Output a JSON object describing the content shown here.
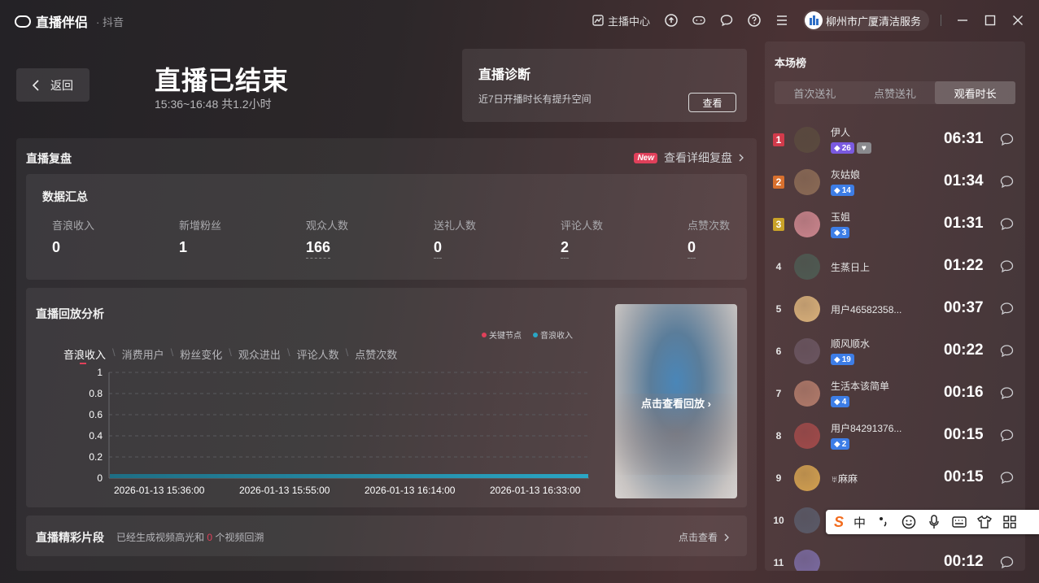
{
  "app": {
    "title": "直播伴侣",
    "subtitle": "· 抖音"
  },
  "titlebar": {
    "anchor_center": "主播中心",
    "icons": [
      "chart-icon",
      "upload-icon",
      "gamepad-icon",
      "chat-bubble-icon",
      "help-icon",
      "menu-icon"
    ],
    "user_name": "柳州市广厦清洁服务"
  },
  "header": {
    "back_label": "返回",
    "title": "直播已结束",
    "time_range": "15:36~16:48 共1.2小时"
  },
  "diagnosis": {
    "title": "直播诊断",
    "desc": "近7日开播时长有提升空间",
    "button": "查看"
  },
  "review": {
    "title": "直播复盘",
    "new_badge": "New",
    "detail_link": "查看详细复盘"
  },
  "summary": {
    "title": "数据汇总",
    "stats": [
      {
        "label": "音浪收入",
        "value": "0"
      },
      {
        "label": "新增粉丝",
        "value": "1"
      },
      {
        "label": "观众人数",
        "value": "166"
      },
      {
        "label": "送礼人数",
        "value": "0"
      },
      {
        "label": "评论人数",
        "value": "2"
      },
      {
        "label": "点赞次数",
        "value": "0"
      }
    ]
  },
  "analysis": {
    "title": "直播回放分析",
    "legend": [
      "关键节点",
      "音浪收入"
    ],
    "tabs": [
      "音浪收入",
      "消费用户",
      "粉丝变化",
      "观众进出",
      "评论人数",
      "点赞次数"
    ],
    "replay_label": "点击查看回放"
  },
  "chart_data": {
    "type": "area",
    "x": [
      "2026-01-13 15:36:00",
      "2026-01-13 15:55:00",
      "2026-01-13 16:14:00",
      "2026-01-13 16:33:00"
    ],
    "y_ticks": [
      "1",
      "0.8",
      "0.6",
      "0.4",
      "0.2",
      "0"
    ],
    "ylim": [
      0,
      1
    ],
    "series": [
      {
        "name": "音浪收入",
        "values": [
          0,
          0,
          0,
          0
        ]
      }
    ],
    "grid": true,
    "legend": "top-right",
    "colors": {
      "series": "#2aa6c4",
      "key_node": "#e0405a"
    }
  },
  "highlight": {
    "title": "直播精彩片段",
    "desc_prefix": "已经生成视频高光和",
    "count": "0",
    "desc_suffix": "个视频回溯",
    "link": "点击查看"
  },
  "ranking": {
    "title": "本场榜",
    "tabs": [
      "首次送礼",
      "点赞送礼",
      "观看时长"
    ],
    "rows": [
      {
        "rank": "1",
        "name": "伊人",
        "badge": "26",
        "time": "06:31"
      },
      {
        "rank": "2",
        "name": "灰姑娘",
        "badge": "14",
        "time": "01:34"
      },
      {
        "rank": "3",
        "name": "玉姐",
        "badge": "3",
        "time": "01:31"
      },
      {
        "rank": "4",
        "name": "生蒸日上",
        "badge": "",
        "time": "01:22"
      },
      {
        "rank": "5",
        "name": "用户46582358...",
        "badge": "",
        "time": "00:37"
      },
      {
        "rank": "6",
        "name": "顺风顺水",
        "badge": "19",
        "time": "00:22"
      },
      {
        "rank": "7",
        "name": "生活本该简单",
        "badge": "4",
        "time": "00:16"
      },
      {
        "rank": "8",
        "name": "用户84291376...",
        "badge": "2",
        "time": "00:15"
      },
      {
        "rank": "9",
        "name": "♅麻麻",
        "badge": "",
        "time": "00:15"
      },
      {
        "rank": "10",
        "name": "",
        "badge": "",
        "time": ""
      },
      {
        "rank": "11",
        "name": "",
        "badge": "",
        "time": "00:12"
      }
    ]
  },
  "ime": {
    "mode": "中"
  }
}
